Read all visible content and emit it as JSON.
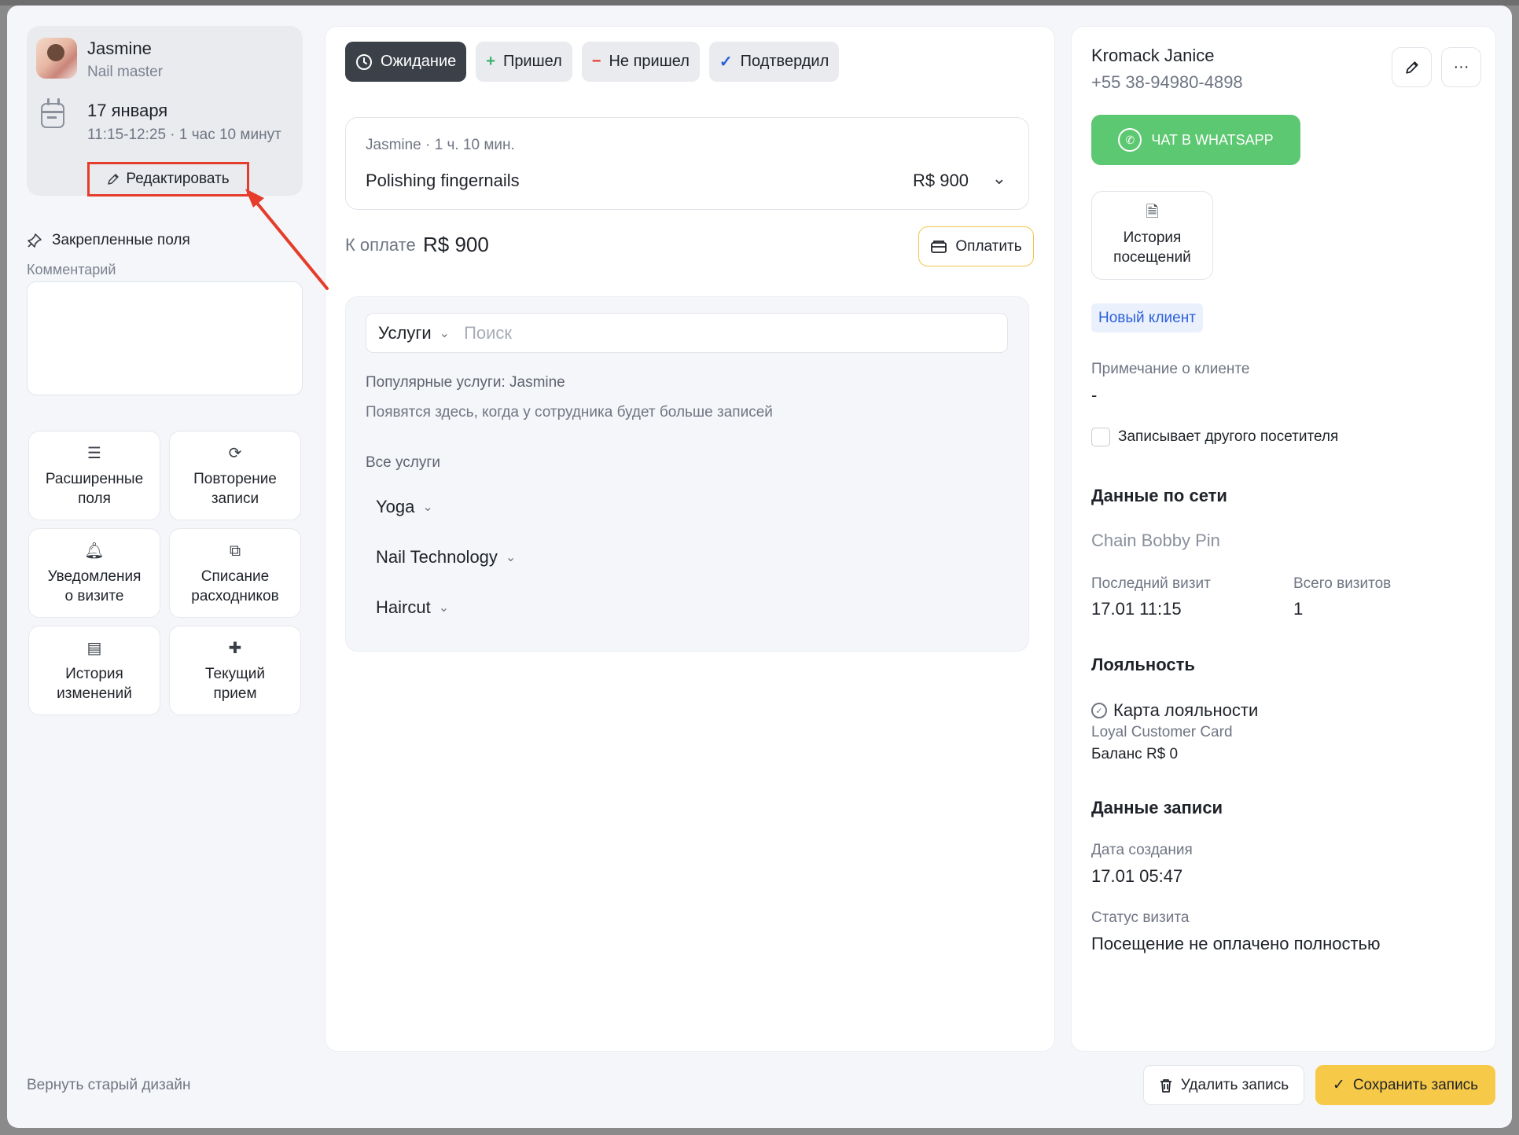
{
  "staff": {
    "name": "Jasmine",
    "role": "Nail master",
    "date": "17 января",
    "time": "11:15-12:25 · 1 час 10 минут",
    "edit_label": "Редактировать"
  },
  "left": {
    "pinned_title": "Закрепленные поля",
    "comment_label": "Комментарий",
    "tiles": [
      {
        "label": "Расширенные\nполя",
        "icon": "list-icon"
      },
      {
        "label": "Повторение\nзаписи",
        "icon": "repeat-icon"
      },
      {
        "label": "Уведомления\nо визите",
        "icon": "bell-icon"
      },
      {
        "label": "Списание\nрасходников",
        "icon": "box-icon"
      },
      {
        "label": "История\nизменений",
        "icon": "archive-icon"
      },
      {
        "label": "Текущий\nприем",
        "icon": "plus-outline-icon"
      }
    ],
    "revert_label": "Вернуть старый дизайн"
  },
  "status": {
    "waiting": "Ожидание",
    "arrived": "Пришел",
    "no_show": "Не пришел",
    "confirmed": "Подтвердил",
    "active": "waiting",
    "colors": {
      "active_bg": "#3c4048",
      "arrived": "#3cb26a",
      "no_show": "#e53c2b",
      "confirmed": "#2b5fd9"
    }
  },
  "service": {
    "meta": "Jasmine · 1 ч. 10 мин.",
    "name": "Polishing fingernails",
    "price": "R$ 900"
  },
  "payment": {
    "label": "К оплате",
    "value": "R$ 900",
    "pay_label": "Оплатить"
  },
  "services_search": {
    "select_label": "Услуги",
    "placeholder": "Поиск",
    "popular_title": "Популярные услуги: Jasmine",
    "popular_hint": "Появятся здесь, когда у сотрудника будет больше записей",
    "all_title": "Все услуги",
    "categories": [
      "Yoga",
      "Nail Technology",
      "Haircut"
    ]
  },
  "client": {
    "name": "Kromack Janice",
    "phone": "+55 38-94980-4898",
    "whatsapp_label": "ЧАТ В WHATSAPP",
    "history_label": "История\nпосещений",
    "new_badge": "Новый клиент",
    "note_label": "Примечание о клиенте",
    "note_value": "-",
    "other_visitor_label": "Записывает другого посетителя",
    "other_visitor_checked": false,
    "brand_colors": {
      "whatsapp": "#5dc872",
      "badge_text": "#2b5fd9"
    }
  },
  "network": {
    "title": "Данные по сети",
    "chain": "Chain Bobby Pin",
    "last_visit_label": "Последний визит",
    "last_visit_value": "17.01 11:15",
    "total_visits_label": "Всего визитов",
    "total_visits_value": "1"
  },
  "loyalty": {
    "title": "Лояльность",
    "card_title": "Карта лояльности",
    "card_name": "Loyal Customer Card",
    "balance": "Баланс R$ 0"
  },
  "record": {
    "title": "Данные записи",
    "created_label": "Дата создания",
    "created_value": "17.01 05:47",
    "status_label": "Статус визита",
    "status_value": "Посещение не оплачено полностью"
  },
  "footer": {
    "delete_label": "Удалить запись",
    "save_label": "Сохранить запись",
    "save_color": "#f7c948"
  }
}
